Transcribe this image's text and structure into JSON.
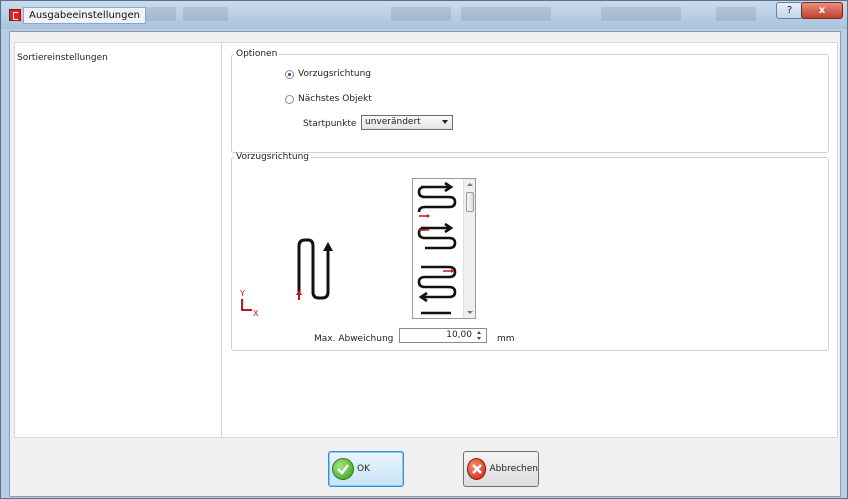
{
  "window": {
    "title": "Ausgabeeinstellungen",
    "help_label": "?",
    "close_label": "x"
  },
  "left_pane": {
    "selected_item": "Sortiereinstellungen"
  },
  "options": {
    "group_label": "Optionen",
    "radio_preferred": "Vorzugsrichtung",
    "radio_nearest": "Nächstes Objekt",
    "selected_radio": "Vorzugsrichtung",
    "start_points_label": "Startpunkte",
    "start_points_value": "unverändert"
  },
  "preferred_direction": {
    "group_label": "Vorzugsrichtung",
    "axis_y": "Y",
    "axis_x": "X",
    "max_deviation_label": "Max. Abweichung",
    "max_deviation_value": "10,00",
    "unit": "mm"
  },
  "buttons": {
    "ok_label": "OK",
    "cancel_label": "Abbrechen"
  },
  "colors": {
    "accent_red": "#d9262a",
    "selection_blue": "#3a8fd0"
  }
}
